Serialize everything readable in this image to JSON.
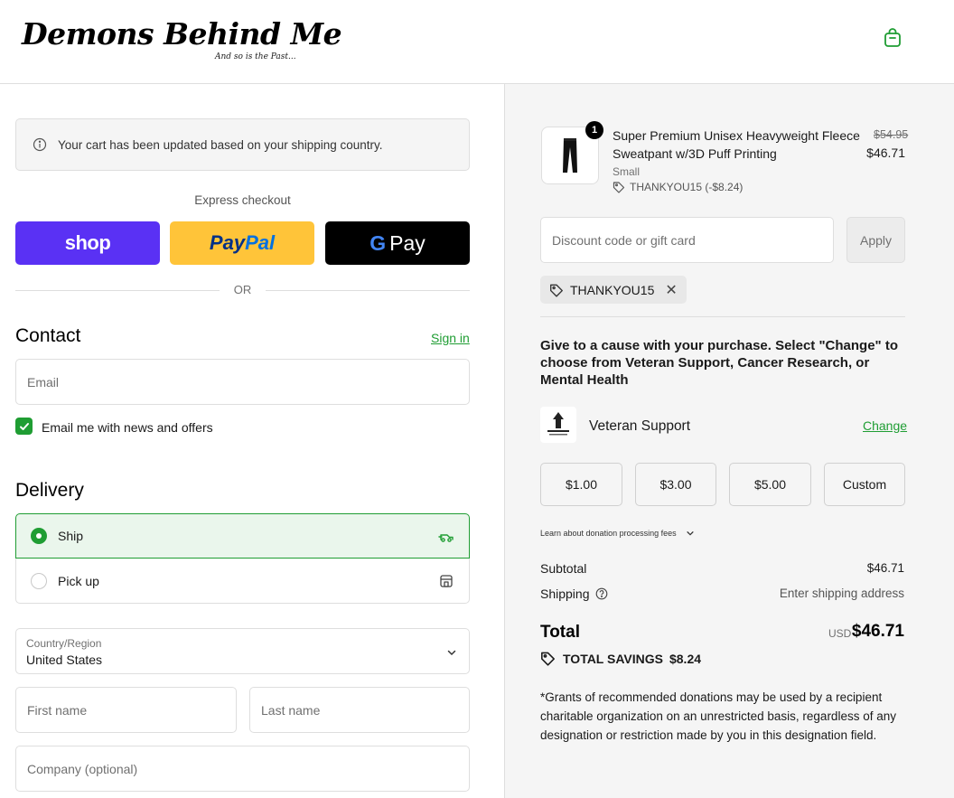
{
  "header": {
    "logo_main": "Demons Behind Me",
    "logo_sub": "And so is the Past..."
  },
  "notice": {
    "text": "Your cart has been updated based on your shipping country."
  },
  "express": {
    "label": "Express checkout",
    "shop_label": "shop",
    "paypal_pay": "Pay",
    "paypal_pal": "Pal",
    "gpay_g": "G",
    "gpay_label": "Pay",
    "or_label": "OR"
  },
  "contact": {
    "title": "Contact",
    "signin": "Sign in",
    "email_placeholder": "Email",
    "newsletter_label": "Email me with news and offers"
  },
  "delivery": {
    "title": "Delivery",
    "ship_label": "Ship",
    "pickup_label": "Pick up",
    "country_label": "Country/Region",
    "country_value": "United States",
    "first_name_placeholder": "First name",
    "last_name_placeholder": "Last name",
    "company_placeholder": "Company (optional)"
  },
  "summary": {
    "product": {
      "qty": "1",
      "name": "Super Premium Unisex Heavyweight Fleece Sweatpant w/3D Puff Printing",
      "variant": "Small",
      "discount": "THANKYOU15 (-$8.24)",
      "price_old": "$54.95",
      "price_new": "$46.71"
    },
    "discount_placeholder": "Discount code or gift card",
    "apply_label": "Apply",
    "chip_code": "THANKYOU15",
    "cause_text": "Give to a cause with your purchase. Select \"Change\" to choose from Veteran Support, Cancer Research, or Mental Health",
    "cause_name": "Veteran Support",
    "change_label": "Change",
    "donations": [
      "$1.00",
      "$3.00",
      "$5.00",
      "Custom"
    ],
    "learn_label": "Learn about donation processing fees",
    "subtotal_label": "Subtotal",
    "subtotal_value": "$46.71",
    "shipping_label": "Shipping",
    "shipping_value": "Enter shipping address",
    "total_label": "Total",
    "currency": "USD",
    "total_value": "$46.71",
    "savings_label": "TOTAL SAVINGS",
    "savings_value": "$8.24",
    "footnote": "*Grants of recommended donations may be used by a recipient charitable organization on an unrestricted basis, regardless of any designation or restriction made by you in this designation field."
  },
  "colors": {
    "accent": "#1f9d33",
    "shop": "#5a31f4",
    "paypal": "#ffc439"
  }
}
